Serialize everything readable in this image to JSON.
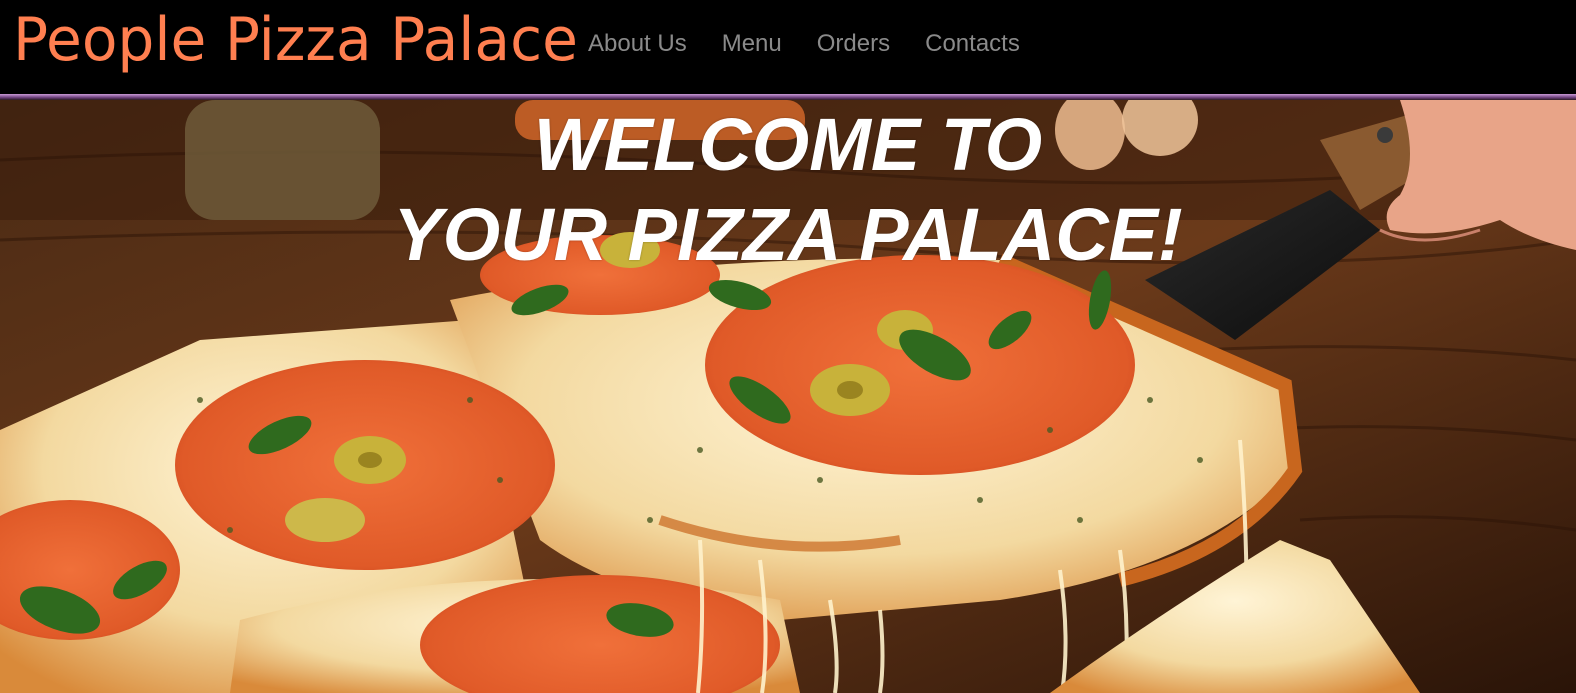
{
  "navbar": {
    "brand": "People Pizza Palace",
    "links": [
      {
        "label": "About Us"
      },
      {
        "label": "Menu"
      },
      {
        "label": "Orders"
      },
      {
        "label": "Contacts"
      }
    ]
  },
  "hero": {
    "title_line1": "WELCOME TO",
    "title_line2": "YOUR PIZZA PALACE!",
    "image_alt": "pizza-hero-photo"
  },
  "colors": {
    "brand": "#ff7f50",
    "nav_link": "#8a8a8a",
    "navbar_bg": "#000000",
    "accent": "#c99ad6",
    "hero_text": "#ffffff"
  }
}
